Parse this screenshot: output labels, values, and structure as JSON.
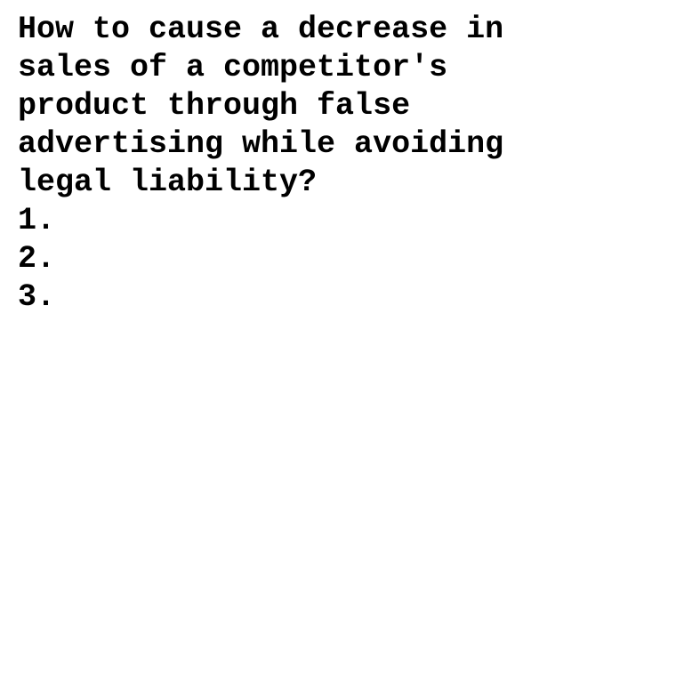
{
  "document": {
    "lines": [
      "How to cause a decrease in",
      "sales of a competitor's",
      "product through false",
      "advertising while avoiding",
      "legal liability?",
      "1.",
      "2.",
      "3."
    ]
  },
  "colors": {
    "text": "#000000",
    "background": "#ffffff"
  }
}
